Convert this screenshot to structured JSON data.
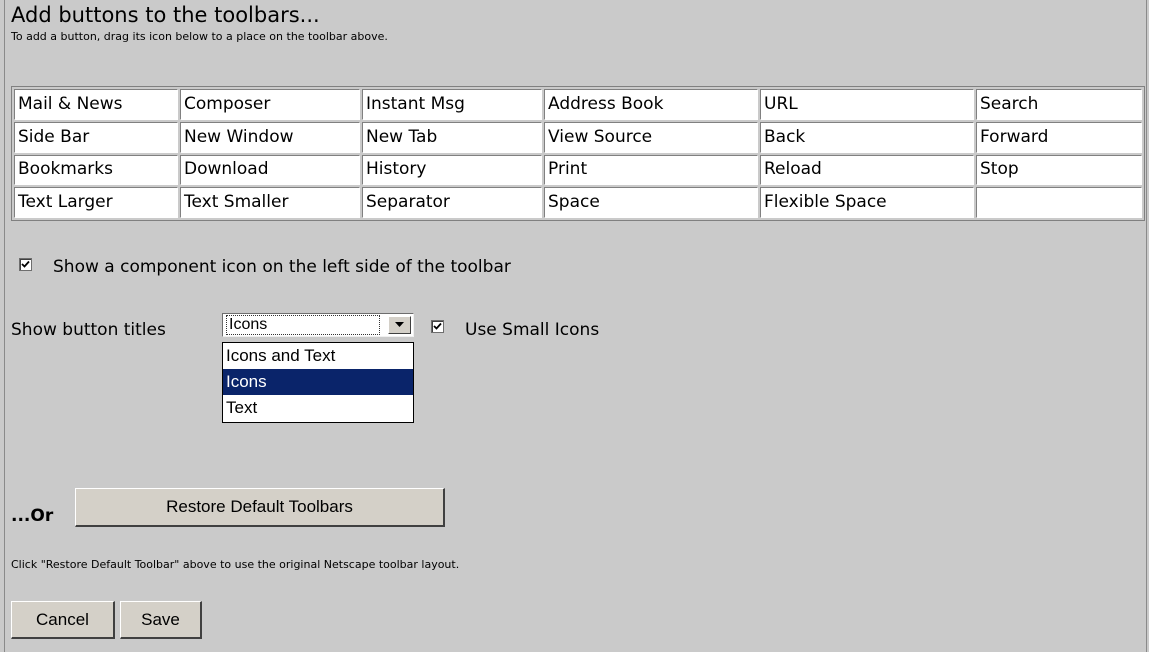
{
  "header": {
    "title": "Add buttons to the toolbars...",
    "subtitle": "To add a button, drag its icon below to a place on the toolbar above."
  },
  "palette": {
    "rows": [
      [
        "Mail & News",
        "Composer",
        "Instant Msg",
        "Address Book",
        "URL",
        "Search"
      ],
      [
        "Side Bar",
        "New Window",
        "New Tab",
        "View Source",
        "Back",
        "Forward"
      ],
      [
        "Bookmarks",
        "Download",
        "History",
        "Print",
        "Reload",
        "Stop"
      ],
      [
        "Text Larger",
        "Text Smaller",
        "Separator",
        "Space",
        "Flexible Space",
        ""
      ]
    ]
  },
  "options": {
    "component_icon_label": "Show a component icon on the left side of the toolbar",
    "component_icon_checked": true,
    "button_titles_label": "Show button titles",
    "button_titles_value": "Icons",
    "button_titles_options": [
      "Icons and Text",
      "Icons",
      "Text"
    ],
    "small_icons_label": "Use Small Icons",
    "small_icons_checked": true
  },
  "restore": {
    "or_label": "...Or",
    "button_label": "Restore Default Toolbars",
    "help_text": "Click \"Restore Default Toolbar\" above to use the original Netscape toolbar layout."
  },
  "actions": {
    "cancel_label": "Cancel",
    "save_label": "Save"
  }
}
